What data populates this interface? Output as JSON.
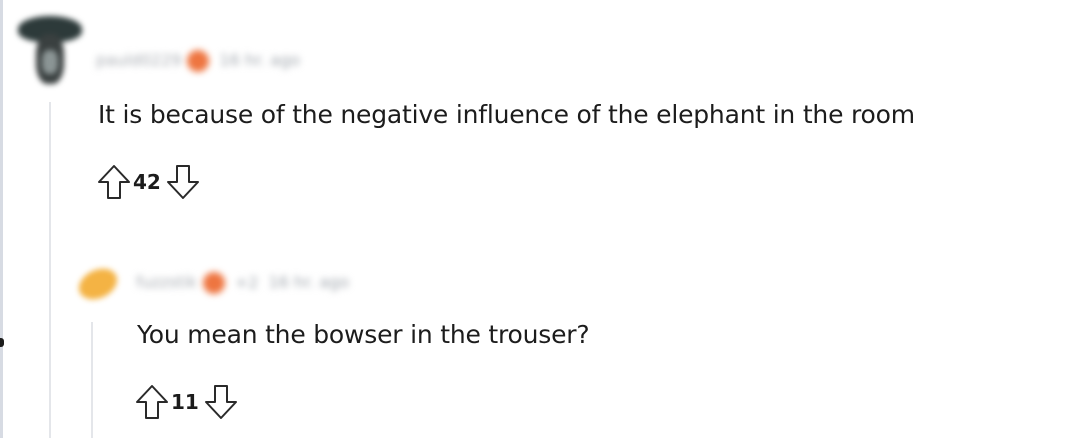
{
  "comments": [
    {
      "author": "pauld0229",
      "time": "16 hr. ago",
      "text": "It is because of the negative influence of the elephant in the room",
      "score": "42"
    },
    {
      "author": "fuzzstik",
      "flair": "+2",
      "time": "16 hr. ago",
      "text": "You mean the bowser in the trouser?",
      "score": "11"
    }
  ],
  "colors": {
    "text": "#1c1c1c",
    "muted": "#a0a6ad",
    "badge": "#ee7540",
    "thread_line": "#e4e6ea"
  },
  "icons": {
    "upvote": "arrow-up-outline-icon",
    "downvote": "arrow-down-outline-icon"
  }
}
